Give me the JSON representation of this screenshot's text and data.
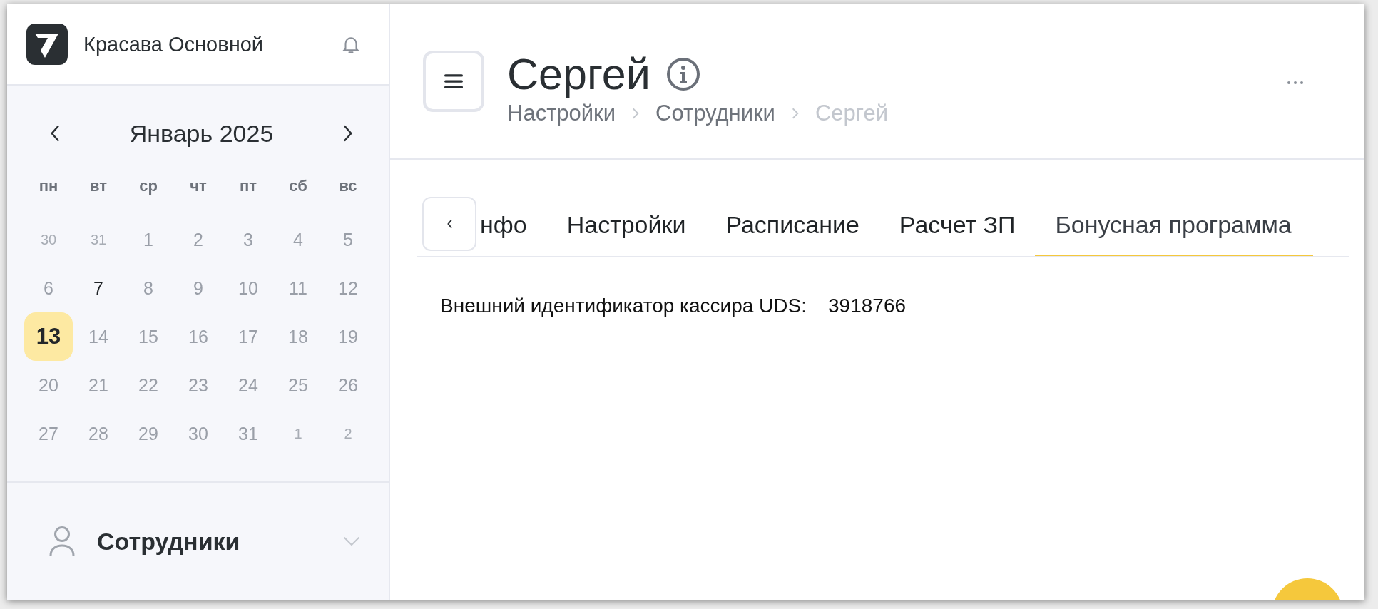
{
  "sidebar": {
    "company": "Красава Основной",
    "calendar": {
      "month": "Январь 2025",
      "weekdays": [
        "пн",
        "вт",
        "ср",
        "чт",
        "пт",
        "сб",
        "вс"
      ],
      "days": [
        {
          "label": "30",
          "outside": true,
          "marked": false,
          "selected": false
        },
        {
          "label": "31",
          "outside": true,
          "marked": false,
          "selected": false
        },
        {
          "label": "1",
          "outside": false,
          "marked": false,
          "selected": false
        },
        {
          "label": "2",
          "outside": false,
          "marked": false,
          "selected": false
        },
        {
          "label": "3",
          "outside": false,
          "marked": false,
          "selected": false
        },
        {
          "label": "4",
          "outside": false,
          "marked": false,
          "selected": false
        },
        {
          "label": "5",
          "outside": false,
          "marked": false,
          "selected": false
        },
        {
          "label": "6",
          "outside": false,
          "marked": false,
          "selected": false
        },
        {
          "label": "7",
          "outside": false,
          "marked": true,
          "selected": false
        },
        {
          "label": "8",
          "outside": false,
          "marked": false,
          "selected": false
        },
        {
          "label": "9",
          "outside": false,
          "marked": false,
          "selected": false
        },
        {
          "label": "10",
          "outside": false,
          "marked": false,
          "selected": false
        },
        {
          "label": "11",
          "outside": false,
          "marked": false,
          "selected": false
        },
        {
          "label": "12",
          "outside": false,
          "marked": false,
          "selected": false
        },
        {
          "label": "13",
          "outside": false,
          "marked": false,
          "selected": true
        },
        {
          "label": "14",
          "outside": false,
          "marked": false,
          "selected": false
        },
        {
          "label": "15",
          "outside": false,
          "marked": false,
          "selected": false
        },
        {
          "label": "16",
          "outside": false,
          "marked": false,
          "selected": false
        },
        {
          "label": "17",
          "outside": false,
          "marked": false,
          "selected": false
        },
        {
          "label": "18",
          "outside": false,
          "marked": false,
          "selected": false
        },
        {
          "label": "19",
          "outside": false,
          "marked": false,
          "selected": false
        },
        {
          "label": "20",
          "outside": false,
          "marked": false,
          "selected": false
        },
        {
          "label": "21",
          "outside": false,
          "marked": false,
          "selected": false
        },
        {
          "label": "22",
          "outside": false,
          "marked": false,
          "selected": false
        },
        {
          "label": "23",
          "outside": false,
          "marked": false,
          "selected": false
        },
        {
          "label": "24",
          "outside": false,
          "marked": false,
          "selected": false
        },
        {
          "label": "25",
          "outside": false,
          "marked": false,
          "selected": false
        },
        {
          "label": "26",
          "outside": false,
          "marked": false,
          "selected": false
        },
        {
          "label": "27",
          "outside": false,
          "marked": false,
          "selected": false
        },
        {
          "label": "28",
          "outside": false,
          "marked": false,
          "selected": false
        },
        {
          "label": "29",
          "outside": false,
          "marked": false,
          "selected": false
        },
        {
          "label": "30",
          "outside": false,
          "marked": false,
          "selected": false
        },
        {
          "label": "31",
          "outside": false,
          "marked": false,
          "selected": false
        },
        {
          "label": "1",
          "outside": true,
          "marked": false,
          "selected": false
        },
        {
          "label": "2",
          "outside": true,
          "marked": false,
          "selected": false
        }
      ]
    },
    "nav_item": {
      "label": "Сотрудники",
      "expanded": false
    }
  },
  "header": {
    "title": "Сергей",
    "breadcrumbs": [
      {
        "label": "Настройки",
        "current": false
      },
      {
        "label": "Сотрудники",
        "current": false
      },
      {
        "label": "Сергей",
        "current": true
      }
    ]
  },
  "tabs": [
    {
      "label": "нфо",
      "selected": false
    },
    {
      "label": "Настройки",
      "selected": false
    },
    {
      "label": "Расписание",
      "selected": false
    },
    {
      "label": "Расчет ЗП",
      "selected": false
    },
    {
      "label": "Бонусная программа",
      "selected": true
    }
  ],
  "content": {
    "label": "Внешний идентификатор кассира UDS:",
    "value": "3918766"
  }
}
